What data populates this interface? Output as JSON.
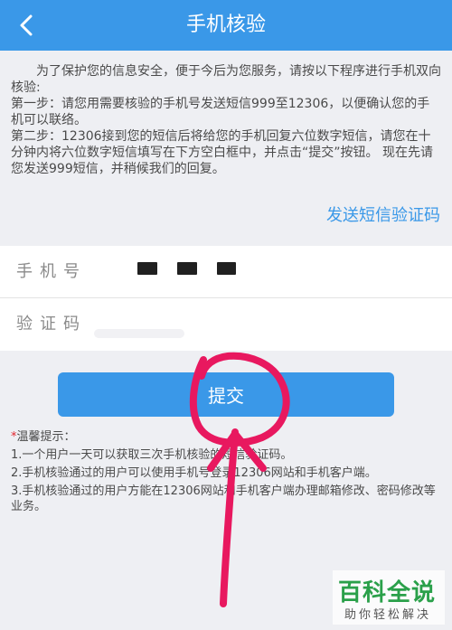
{
  "header": {
    "back_icon": "chevron-left-icon",
    "title": "手机核验"
  },
  "intro": {
    "paragraph1": "为了保护您的信息安全，便于今后为您服务，请按以下程序进行手机双向核验:",
    "step1": "第一步：请您用需要核验的手机号发送短信999至12306，以便确认您的手机可以联络。",
    "step2": "第二步：12306接到您的短信后将给您的手机回复六位数字短信，请您在十分钟内将六位数字短信填写在下方空白框中，并点击“提交”按钮。 现在先请您发送999短信，并稍候我们的回复。"
  },
  "send_sms_link": "发送短信验证码",
  "form": {
    "phone_label": "手机号",
    "code_label": "验证码",
    "code_value": "",
    "code_placeholder": ""
  },
  "submit_label": "提交",
  "tips": {
    "star": "*",
    "title": "温馨提示：",
    "items": [
      "1.一个用户一天可以获取三次手机核验的短信验证码。",
      "2.手机核验通过的用户可以使用手机号登录12306网站和手机客户端。",
      "3.手机核验通过的用户方能在12306网站和手机客户端办理邮箱修改、密码修改等业务。"
    ]
  },
  "watermark": {
    "main": "百科全说",
    "sub": "助你轻松解决"
  },
  "colors": {
    "accent": "#3a98e8",
    "annotation": "#e8185f",
    "watermark": "#2aa04a"
  }
}
